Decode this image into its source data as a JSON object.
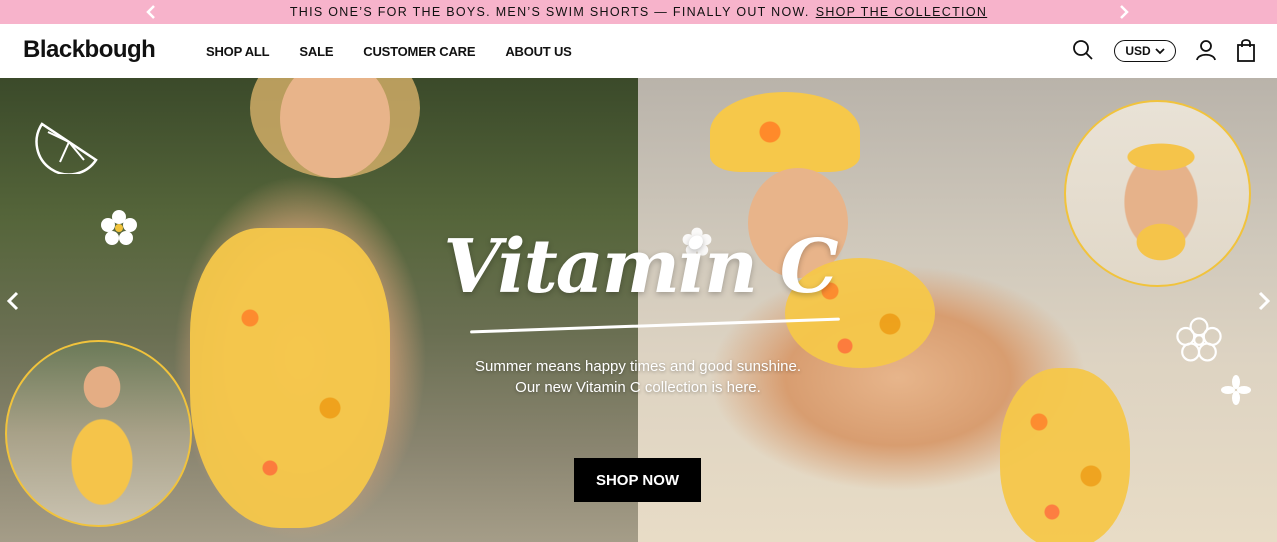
{
  "announcement": {
    "text": "THIS ONE’S FOR THE BOYS. MEN’S SWIM SHORTS — FINALLY OUT NOW.",
    "link": "SHOP THE COLLECTION",
    "background": "#f7b3cb"
  },
  "header": {
    "logo": "Blackbough",
    "nav": [
      {
        "label": "SHOP ALL"
      },
      {
        "label": "SALE"
      },
      {
        "label": "CUSTOMER CARE"
      },
      {
        "label": "ABOUT US"
      }
    ],
    "currency": "USD",
    "icons": [
      "search-icon",
      "user-icon",
      "cart-icon"
    ]
  },
  "hero": {
    "title": "Vitamin C",
    "subtitle_line1": "Summer means happy times and good sunshine.",
    "subtitle_line2": "Our new Vitamin C collection is here.",
    "cta": "SHOP NOW",
    "accent": "#f1c33c"
  }
}
